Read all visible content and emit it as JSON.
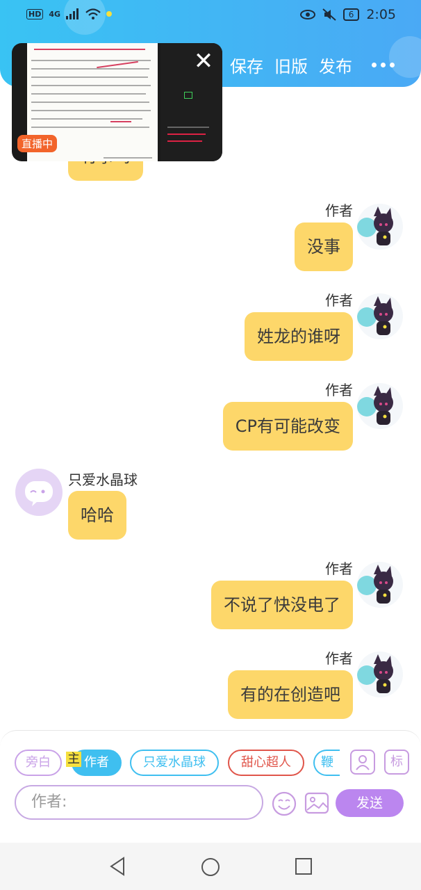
{
  "status_bar": {
    "left_tags": [
      "HD",
      "4G"
    ],
    "battery": "6",
    "time": "2:05"
  },
  "header": {
    "actions": [
      "保存",
      "旧版",
      "发布"
    ],
    "more_icon": "more-dots-icon",
    "bg_color": "#3fb8f4"
  },
  "live_overlay": {
    "badge": "直播中",
    "close_icon": "close-icon"
  },
  "messages": [
    {
      "side": "left",
      "sender": "",
      "text": "有事吗",
      "partial": true
    },
    {
      "side": "right",
      "sender": "作者",
      "text": "没事"
    },
    {
      "side": "right",
      "sender": "作者",
      "text": "姓龙的谁呀"
    },
    {
      "side": "right",
      "sender": "作者",
      "text": "CP有可能改变"
    },
    {
      "side": "left",
      "sender": "只爱水晶球",
      "text": "哈哈"
    },
    {
      "side": "right",
      "sender": "作者",
      "text": "不说了快没电了"
    },
    {
      "side": "right",
      "sender": "作者",
      "text": "有的在创造吧"
    }
  ],
  "composer": {
    "role_chips": [
      {
        "label": "旁白",
        "color": "#c9a2e8"
      },
      {
        "label": "作者",
        "color": "#3fbff0",
        "active": true
      },
      {
        "label": "只爱水晶球",
        "color": "#3fbff0"
      },
      {
        "label": "甜心超人",
        "color": "#e0554a"
      },
      {
        "label": "鞭",
        "color": "#3fbff0"
      }
    ],
    "main_tag": "主",
    "add_role_icon": "person-icon",
    "tag_icon_label": "标",
    "input_placeholder": "作者:",
    "emoji_icon": "emoji-icon",
    "image_icon": "image-icon",
    "send_label": "发送",
    "accent": "#bb86ef"
  },
  "nav": {
    "back_icon": "back-triangle-icon",
    "home_icon": "home-circle-icon",
    "recent_icon": "recent-square-icon"
  }
}
